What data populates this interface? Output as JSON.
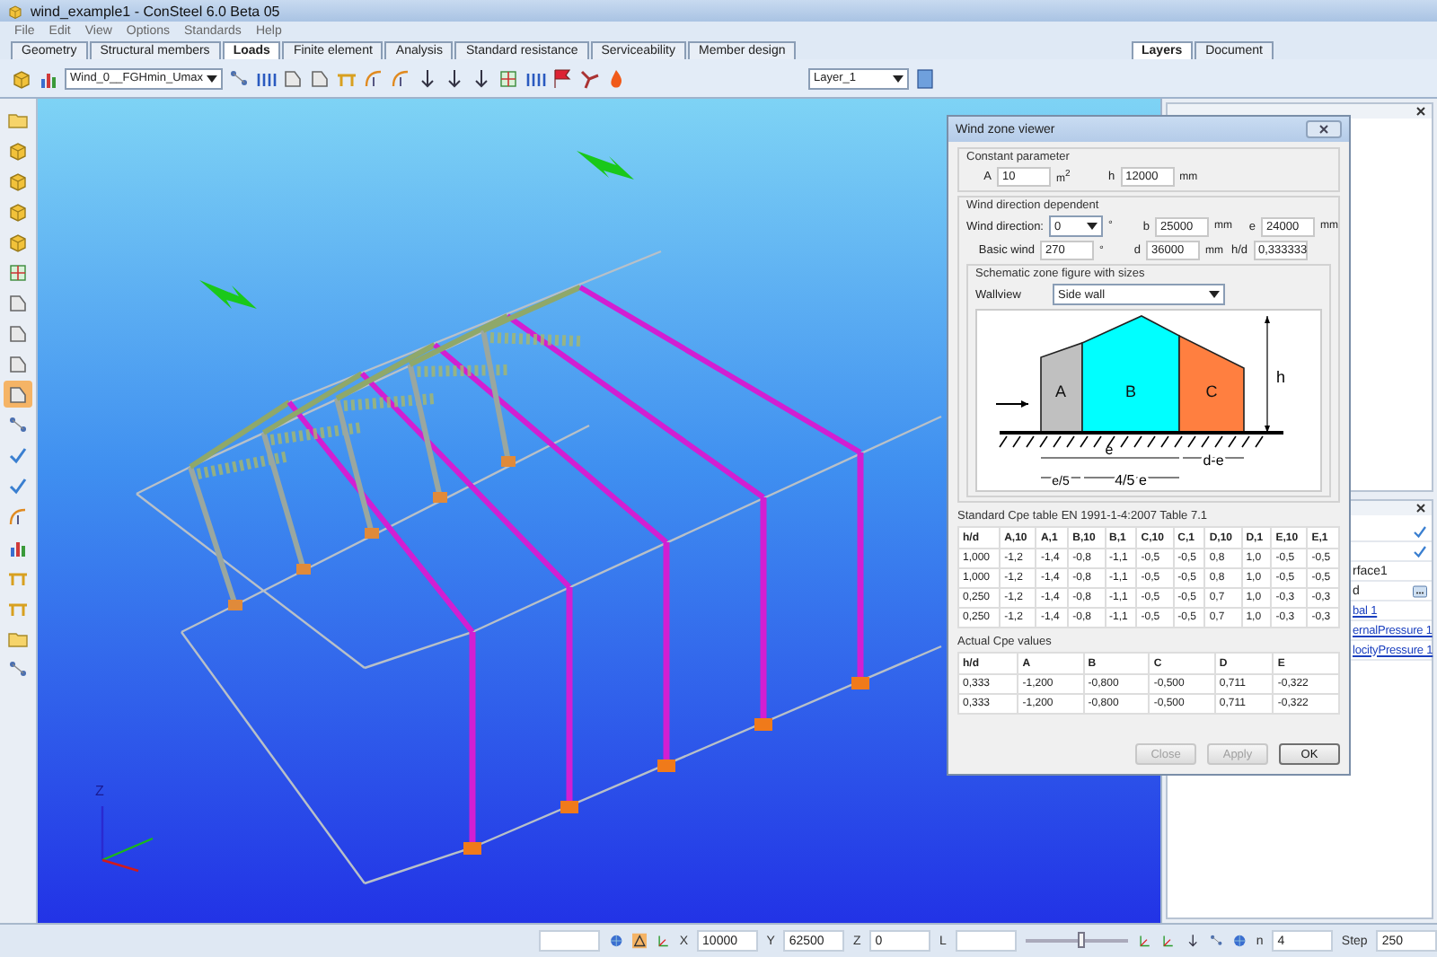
{
  "window": {
    "title": "wind_example1 - ConSteel 6.0 Beta 05"
  },
  "menu": [
    "File",
    "Edit",
    "View",
    "Options",
    "Standards",
    "Help"
  ],
  "ribbon_tabs": [
    {
      "label": "Geometry",
      "selected": false
    },
    {
      "label": "Structural members",
      "selected": false
    },
    {
      "label": "Loads",
      "selected": true
    },
    {
      "label": "Finite element",
      "selected": false
    },
    {
      "label": "Analysis",
      "selected": false
    },
    {
      "label": "Standard resistance",
      "selected": false
    },
    {
      "label": "Serviceability",
      "selected": false
    },
    {
      "label": "Member design",
      "selected": false
    }
  ],
  "side_tabs": [
    {
      "label": "Layers",
      "selected": true
    },
    {
      "label": "Document",
      "selected": false
    }
  ],
  "toolbar": {
    "load_case": "Wind_0__FGHmin_Umax",
    "layer": "Layer_1"
  },
  "left_tools": [
    {
      "kind": "folder",
      "selected": false
    },
    {
      "kind": "cube",
      "selected": false
    },
    {
      "kind": "cube",
      "selected": false
    },
    {
      "kind": "cube",
      "selected": false
    },
    {
      "kind": "cube",
      "selected": false
    },
    {
      "kind": "grid",
      "selected": false
    },
    {
      "kind": "plate",
      "selected": false
    },
    {
      "kind": "plate",
      "selected": false
    },
    {
      "kind": "plate",
      "selected": false
    },
    {
      "kind": "plate",
      "selected": true
    },
    {
      "kind": "node",
      "selected": false
    },
    {
      "kind": "check",
      "selected": false
    },
    {
      "kind": "check",
      "selected": false
    },
    {
      "kind": "arc",
      "selected": false
    },
    {
      "kind": "chart",
      "selected": false
    },
    {
      "kind": "beam",
      "selected": false
    },
    {
      "kind": "beam",
      "selected": false
    },
    {
      "kind": "folder",
      "selected": false
    },
    {
      "kind": "node",
      "selected": false
    }
  ],
  "viewport": {
    "axis_label": "Z"
  },
  "properties_panel": {
    "rows": [
      {
        "kind": "check"
      },
      {
        "kind": "check"
      },
      {
        "kind": "text",
        "text": "rface1"
      },
      {
        "kind": "picker",
        "text": "d"
      },
      {
        "kind": "link",
        "text": "bal 1"
      },
      {
        "kind": "link",
        "text": "ernalPressure 1"
      },
      {
        "kind": "link",
        "text": "locityPressure 1"
      }
    ]
  },
  "dialog": {
    "title": "Wind zone viewer",
    "constant": {
      "title": "Constant parameter",
      "fields": [
        {
          "label": "A",
          "value": "10",
          "unit": "m$^{2}$"
        },
        {
          "label": "h",
          "value": "12000",
          "unit": "mm"
        }
      ]
    },
    "direction": {
      "title": "Wind direction dependent",
      "rows": [
        [
          {
            "label": "Wind direction:",
            "value": "0",
            "kind": "select",
            "unit": "°"
          },
          {
            "label": "b",
            "value": "25000",
            "kind": "input",
            "unit": "mm"
          },
          {
            "label": "e",
            "value": "24000",
            "kind": "input",
            "unit": "mm"
          }
        ],
        [
          {
            "label": "Basic wind",
            "value": "270",
            "kind": "input",
            "unit": "°"
          },
          {
            "label": "d",
            "value": "36000",
            "kind": "input",
            "unit": "mm"
          },
          {
            "label": "h/d",
            "value": "0,333333",
            "kind": "input"
          }
        ]
      ]
    },
    "schematic": {
      "title": "Schematic zone figure with sizes",
      "view_label": "Wallview",
      "view_value": "Side wall",
      "figure": {
        "zones": [
          {
            "label": "A",
            "color": "#c0c0c0"
          },
          {
            "label": "B",
            "color": "#00ffff"
          },
          {
            "label": "C",
            "color": "#ff7f40"
          }
        ],
        "height_label": "h",
        "dims": [
          "e",
          "d-e",
          "e/5",
          "4/5 e"
        ]
      }
    },
    "standard_table": {
      "title": "Standard Cpe table EN 1991-1-4:2007 Table 7.1",
      "columns": [
        "h/d",
        "A,10",
        "A,1",
        "B,10",
        "B,1",
        "C,10",
        "C,1",
        "D,10",
        "D,1",
        "E,10",
        "E,1"
      ],
      "rows": [
        [
          "1,000",
          "-1,2",
          "-1,4",
          "-0,8",
          "-1,1",
          "-0,5",
          "-0,5",
          "0,8",
          "1,0",
          "-0,5",
          "-0,5"
        ],
        [
          "1,000",
          "-1,2",
          "-1,4",
          "-0,8",
          "-1,1",
          "-0,5",
          "-0,5",
          "0,8",
          "1,0",
          "-0,5",
          "-0,5"
        ],
        [
          "0,250",
          "-1,2",
          "-1,4",
          "-0,8",
          "-1,1",
          "-0,5",
          "-0,5",
          "0,7",
          "1,0",
          "-0,3",
          "-0,3"
        ],
        [
          "0,250",
          "-1,2",
          "-1,4",
          "-0,8",
          "-1,1",
          "-0,5",
          "-0,5",
          "0,7",
          "1,0",
          "-0,3",
          "-0,3"
        ]
      ]
    },
    "actual_table": {
      "title": "Actual Cpe values",
      "columns": [
        "h/d",
        "A",
        "B",
        "C",
        "D",
        "E"
      ],
      "rows": [
        [
          "0,333",
          "-1,200",
          "-0,800",
          "-0,500",
          "0,711",
          "-0,322"
        ],
        [
          "0,333",
          "-1,200",
          "-0,800",
          "-0,500",
          "0,711",
          "-0,322"
        ]
      ]
    },
    "buttons": [
      {
        "label": "Close",
        "disabled": true
      },
      {
        "label": "Apply",
        "disabled": true
      },
      {
        "label": "OK",
        "disabled": false
      }
    ]
  },
  "status_bar": {
    "coordinates": [
      {
        "label": "X",
        "value": "10000"
      },
      {
        "label": "Y",
        "value": "62500"
      },
      {
        "label": "Z",
        "value": "0"
      },
      {
        "label": "L"
      }
    ],
    "slider": {
      "level": 0.55
    },
    "steps": [
      {
        "label": "n",
        "value": "4"
      },
      {
        "label": "Step",
        "value": "250"
      }
    ]
  }
}
